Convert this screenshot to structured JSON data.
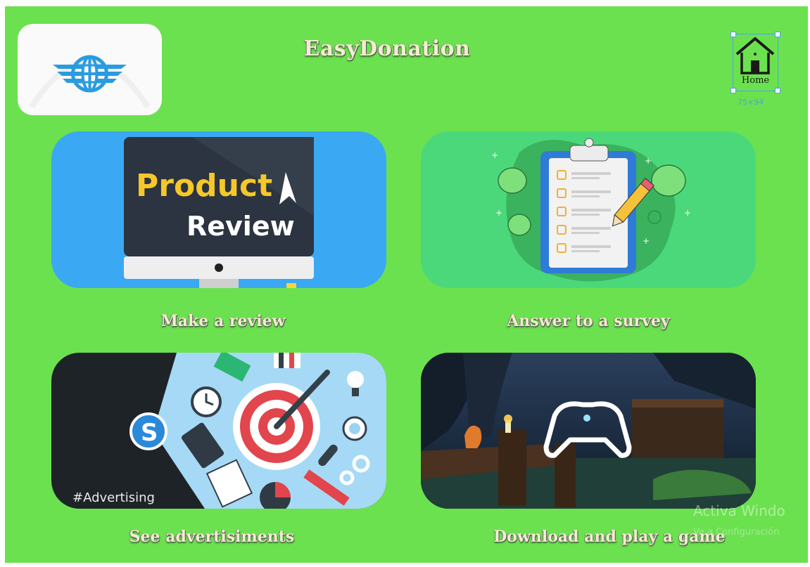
{
  "app": {
    "title": "EasyDonation"
  },
  "home": {
    "label": "Home",
    "dimensions": "75×94"
  },
  "cards": [
    {
      "label": "Make a review",
      "image_text_1": "Product",
      "image_text_2": "Review"
    },
    {
      "label": "Answer to a survey"
    },
    {
      "label": "See advertisiments",
      "image_text": "#Advertising"
    },
    {
      "label": "Download and play a game"
    }
  ],
  "watermark": {
    "line1": "Activa Windo",
    "line2": "Ve a Configuración"
  },
  "colors": {
    "background": "#6be14f",
    "title": "#f3edcf",
    "review_card": "#3aa8f2",
    "survey_card": "#4bd87b",
    "selection": "#4aa3e6"
  }
}
